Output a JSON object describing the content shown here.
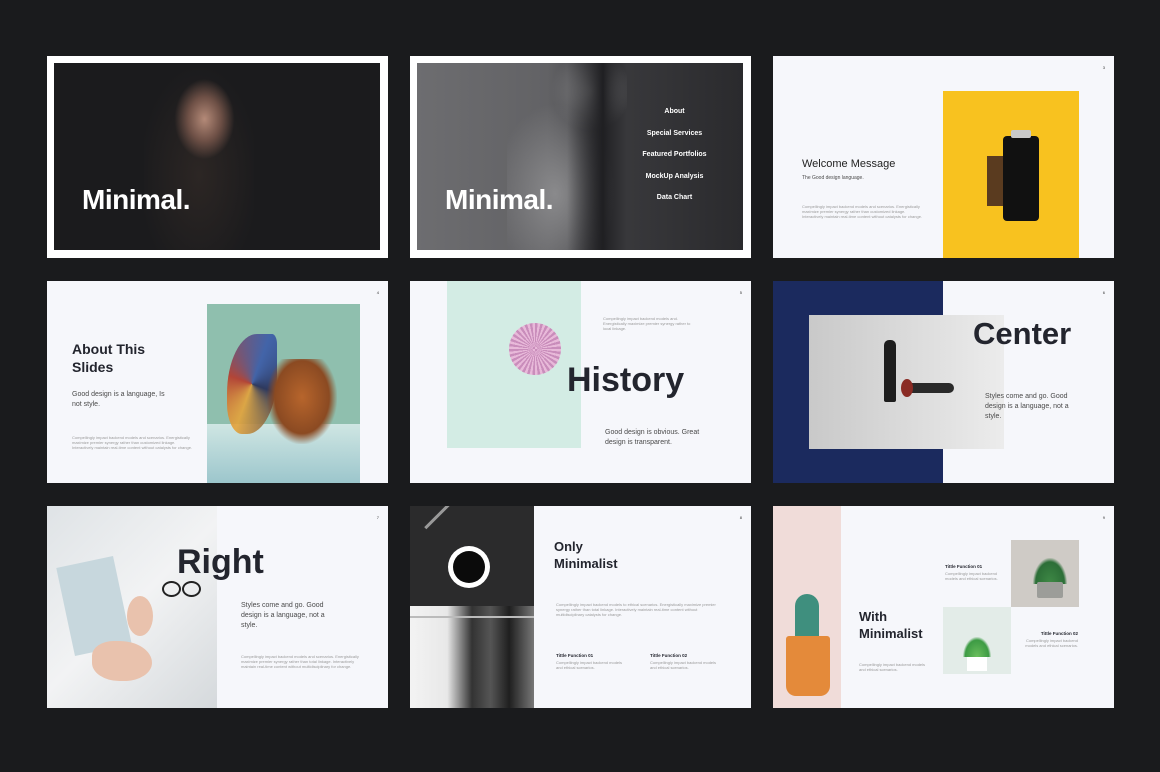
{
  "slides": {
    "s1": {
      "title": "Minimal."
    },
    "s2": {
      "title": "Minimal.",
      "menu": [
        "About",
        "Special Services",
        "Featured Portfolios",
        "MockUp Analysis",
        "Data Chart"
      ]
    },
    "s3": {
      "page": "3",
      "title": "Welcome Message",
      "subtitle": "The Good design language.",
      "body": "Compellingly impact backend models and scenarios. Energistically maximize premier synergy rather than customized linkage. Interactively maintain real-time content without catalysts for change."
    },
    "s4": {
      "page": "4",
      "title": "About This Slides",
      "tagline": "Good design is a language, Is not style.",
      "body": "Compellingly impact backend models and scenarios. Energistically maximize premier synergy rather than customized linkage. Interactively maintain real-time content without catalysts for change."
    },
    "s5": {
      "page": "5",
      "title": "History",
      "body": "Compellingly impact backend models and. Energistically maximize premier synergy rather to local linkage.",
      "tagline": "Good design is obvious. Great design is transparent."
    },
    "s6": {
      "page": "6",
      "title": "Center",
      "tagline": "Styles come and go. Good design is a language, not a style."
    },
    "s7": {
      "page": "7",
      "title": "Right",
      "tagline": "Styles come and go. Good design is a language, not a style.",
      "body": "Compellingly impact backend models and scenarios. Energistically maximize premier synergy rather than total linkage. Interactively maintain real-time content without multidisciplinary for change."
    },
    "s8": {
      "page": "8",
      "title": "Only Minimalist",
      "body": "Compellingly impact backend models to ethical scenarios. Energistically maximize premier synergy rather than total linkage. Interactively maintain real-time content without multidisciplinary catalysts for change.",
      "functions": [
        {
          "title": "Tittle Function 01",
          "text": "Compellingly impact backend models and ethical scenarios."
        },
        {
          "title": "Tittle Function 02",
          "text": "Compellingly impact backend models and ethical scenarios."
        }
      ]
    },
    "s9": {
      "page": "9",
      "title": "With Minimalist",
      "body": "Compellingly impact backend models and ethical scenarios.",
      "functions": [
        {
          "title": "Tittle Function 01",
          "text": "Compellingly impact backend models and ethical scenarios."
        },
        {
          "title": "Tittle Function 02",
          "text": "Compellingly impact backend models and ethical scenarios."
        }
      ]
    }
  },
  "colors": {
    "background": "#1a1b1d",
    "slide": "#f6f7fb",
    "dark_text": "#23252e",
    "yellow": "#f8c21f",
    "mint": "#d3ece4",
    "navy": "#1b2a5e"
  }
}
